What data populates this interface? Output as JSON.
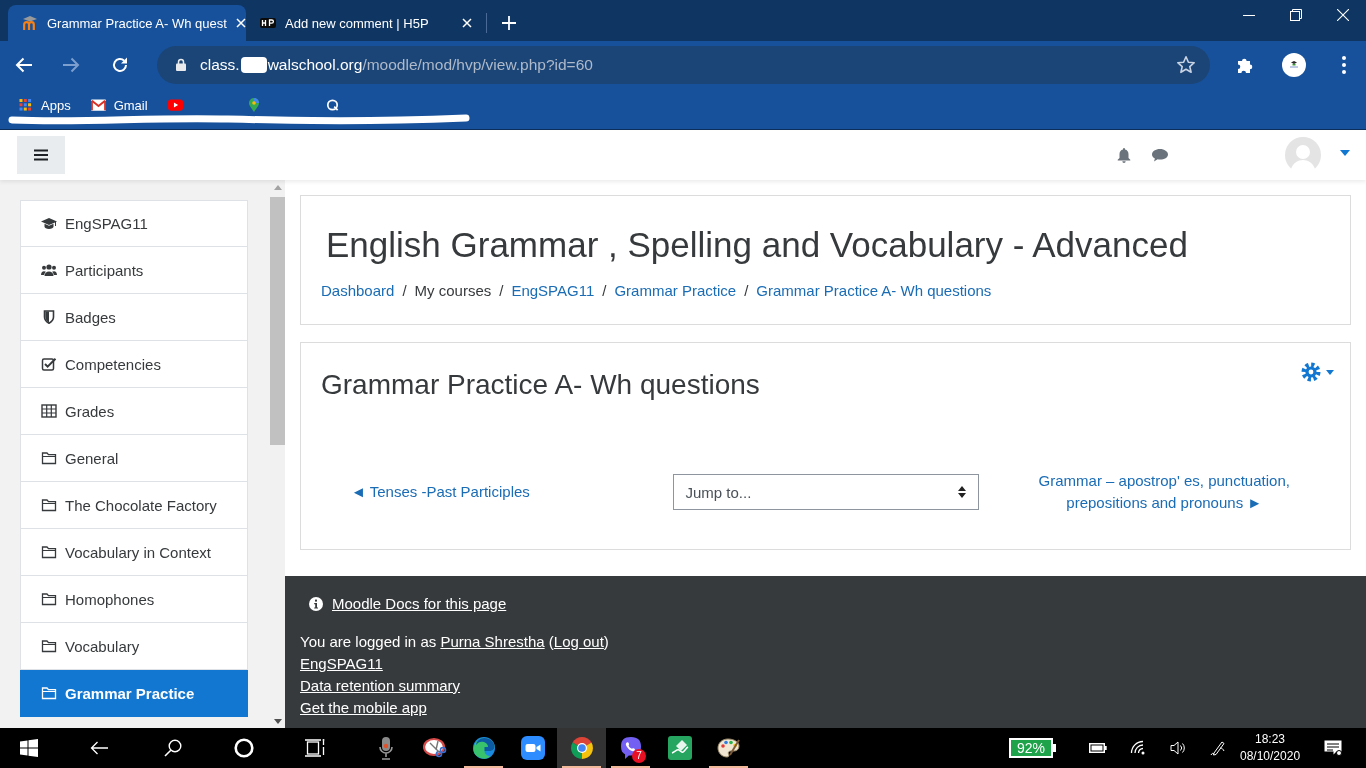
{
  "browser": {
    "tabs": [
      {
        "title": "Grammar Practice A- Wh quest",
        "kind": "moodle",
        "selected": true
      },
      {
        "title": "Add new comment | H5P",
        "kind": "h5p",
        "selected": false
      }
    ],
    "forward_disabled": true,
    "address": {
      "host_start": "class.",
      "host_end": "walschool.org",
      "path": "/moodle/mod/hvp/view.php?id=60"
    },
    "bookmarks": [
      {
        "label": "Apps",
        "kind": "apps"
      },
      {
        "label": "Gmail",
        "kind": "gmail"
      },
      {
        "kind": "youtube"
      },
      {
        "kind": "maps"
      },
      {
        "kind": "site"
      }
    ]
  },
  "sidebar": {
    "items": [
      {
        "label": "EngSPAG11",
        "kind": "course",
        "selected": false
      },
      {
        "label": "Participants",
        "kind": "participants",
        "selected": false
      },
      {
        "label": "Badges",
        "kind": "badges",
        "selected": false
      },
      {
        "label": "Competencies",
        "kind": "competencies",
        "selected": false
      },
      {
        "label": "Grades",
        "kind": "grades",
        "selected": false
      },
      {
        "label": "General",
        "kind": "section",
        "selected": false
      },
      {
        "label": "The Chocolate Factory",
        "kind": "section",
        "selected": false
      },
      {
        "label": "Vocabulary in Context",
        "kind": "section",
        "selected": false
      },
      {
        "label": "Homophones",
        "kind": "section",
        "selected": false
      },
      {
        "label": "Vocabulary",
        "kind": "section",
        "selected": false
      },
      {
        "label": "Grammar Practice",
        "kind": "section",
        "selected": true
      }
    ]
  },
  "page_header": {
    "title": "English Grammar , Spelling and Vocabulary - Advanced",
    "breadcrumb": [
      {
        "label": "Dashboard",
        "link": true
      },
      {
        "sep": "/",
        "label": "My courses",
        "link": false
      },
      {
        "sep": "/",
        "label": "EngSPAG11",
        "link": true
      },
      {
        "sep": "/",
        "label": "Grammar Practice",
        "link": true
      },
      {
        "sep": "/",
        "label": "Grammar Practice A- Wh questions",
        "link": true
      }
    ]
  },
  "activity": {
    "title": "Grammar Practice A- Wh questions",
    "prev_link": "◄ Tenses -Past Participles",
    "jump_to": "Jump to...",
    "next_link": "Grammar – apostrop' es, punctuation, prepositions and pronouns ►"
  },
  "footer": {
    "docs_link": "Moodle Docs for this page",
    "login": {
      "prefix": "You are logged in as ",
      "user": "Purna Shrestha",
      "middle": " (",
      "logout": "Log out",
      "suffix": ")"
    },
    "links": [
      "EngSPAG11",
      "Data retention summary",
      "Get the mobile app"
    ]
  },
  "taskbar": {
    "apps": [
      {
        "kind": "mic",
        "running": false,
        "active": false
      },
      {
        "kind": "snip",
        "running": false,
        "active": false
      },
      {
        "kind": "edge",
        "running": true,
        "active": false
      },
      {
        "kind": "zoom",
        "running": false,
        "active": false
      },
      {
        "kind": "chrome",
        "running": true,
        "active": true
      },
      {
        "kind": "viber",
        "running": true,
        "active": false,
        "badge": "7"
      },
      {
        "kind": "whiteboard",
        "running": false,
        "active": false
      },
      {
        "kind": "paint",
        "running": true,
        "active": false
      }
    ],
    "battery": "92%",
    "time": "18:23",
    "date": "08/10/2020"
  }
}
